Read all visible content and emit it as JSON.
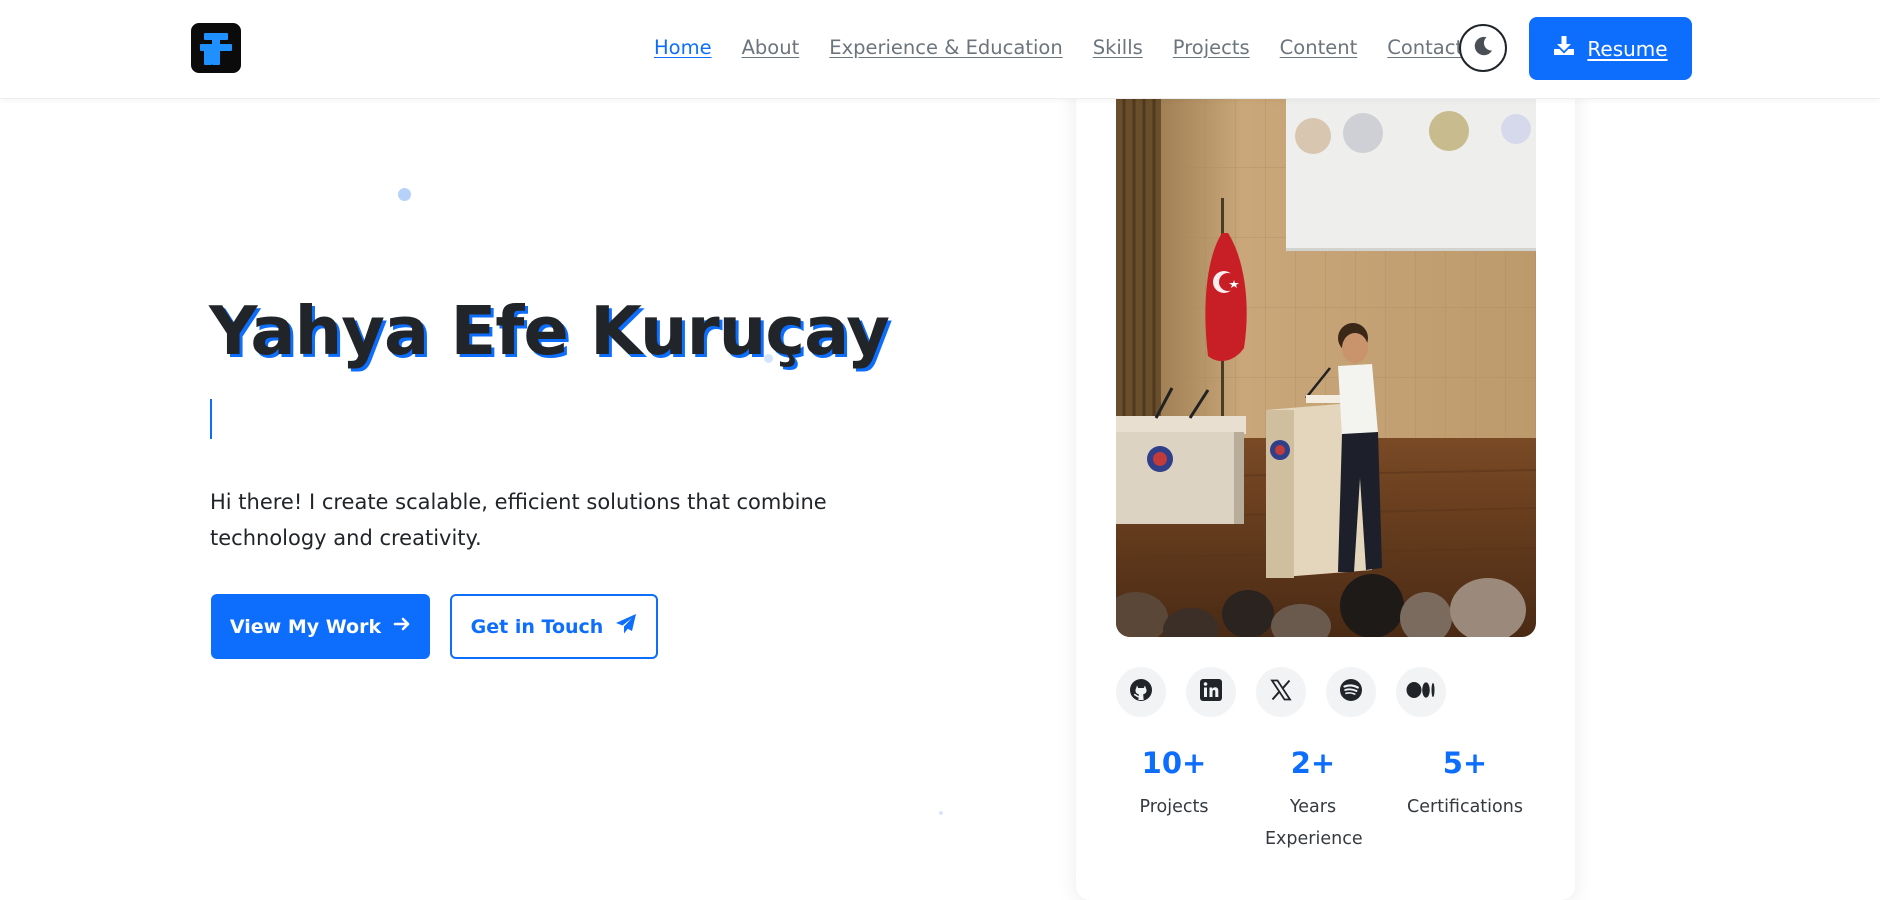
{
  "brand": {
    "logo_icon": "fe-monogram-logo",
    "accent_color": "#0d6efd",
    "logo_color": "#1e90ff"
  },
  "nav": {
    "items": [
      {
        "label": "Home",
        "active": true
      },
      {
        "label": "About",
        "active": false
      },
      {
        "label": "Experience & Education",
        "active": false
      },
      {
        "label": "Skills",
        "active": false
      },
      {
        "label": "Projects",
        "active": false
      },
      {
        "label": "Content",
        "active": false
      },
      {
        "label": "Contact",
        "active": false
      }
    ],
    "theme_toggle_icon": "moon-icon",
    "resume_label": "Resume",
    "resume_icon": "download-icon"
  },
  "hero": {
    "name": "Yahya Efe Kuruçay",
    "typed_text": "",
    "description": "Hi there! I create scalable, efficient solutions that combine technology and creativity.",
    "primary_button": {
      "label": "View My Work",
      "icon": "arrow-right-icon"
    },
    "secondary_button": {
      "label": "Get in Touch",
      "icon": "paper-plane-icon"
    }
  },
  "profile": {
    "photo_icon": "speaker-at-podium-photo",
    "socials": [
      {
        "name": "github",
        "icon": "github-icon"
      },
      {
        "name": "linkedin",
        "icon": "linkedin-icon"
      },
      {
        "name": "x",
        "icon": "x-icon"
      },
      {
        "name": "spotify",
        "icon": "spotify-icon"
      },
      {
        "name": "medium",
        "icon": "medium-icon"
      }
    ],
    "stats": [
      {
        "value": "10+",
        "label": "Projects"
      },
      {
        "value": "2+",
        "label": "Years Experience"
      },
      {
        "value": "5+",
        "label": "Certifications"
      }
    ]
  }
}
